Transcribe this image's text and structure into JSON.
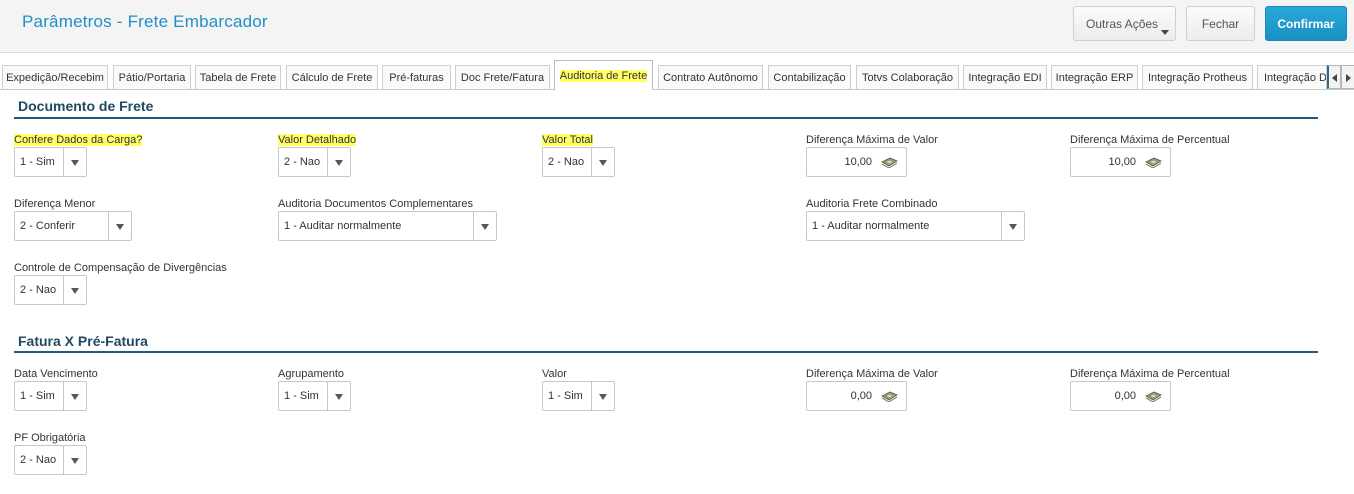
{
  "header": {
    "title": "Parâmetros - Frete Embarcador",
    "buttons": {
      "outras": "Outras Ações",
      "fechar": "Fechar",
      "confirmar": "Confirmar"
    }
  },
  "tabs": [
    "Expedição/Recebim",
    "Pátio/Portaria",
    "Tabela de Frete",
    "Cálculo de Frete",
    "Pré-faturas",
    "Doc Frete/Fatura",
    "Auditoria de Frete",
    "Contrato Autônomo",
    "Contabilização",
    "Totvs Colaboração",
    "Integração EDI",
    "Integração ERP",
    "Integração Protheus",
    "Integração D"
  ],
  "sections": {
    "doc": {
      "title": "Documento de Frete",
      "confere": {
        "label": "Confere Dados da Carga?",
        "value": "1 - Sim"
      },
      "valor_detalhado": {
        "label": "Valor Detalhado",
        "value": "2 - Nao"
      },
      "valor_total": {
        "label": "Valor Total",
        "value": "2 - Nao"
      },
      "dif_valor": {
        "label": "Diferença Máxima de Valor",
        "value": "10,00"
      },
      "dif_percentual": {
        "label": "Diferença Máxima de Percentual",
        "value": "10,00"
      },
      "dif_menor": {
        "label": "Diferença Menor",
        "value": "2 - Conferir"
      },
      "aud_complementares": {
        "label": "Auditoria Documentos Complementares",
        "value": "1 - Auditar normalmente"
      },
      "aud_combinado": {
        "label": "Auditoria Frete Combinado",
        "value": "1 - Auditar normalmente"
      },
      "controle_compensacao": {
        "label": "Controle de Compensação de Divergências",
        "value": "2 - Nao"
      }
    },
    "fatura": {
      "title": "Fatura X Pré-Fatura",
      "data_vencimento": {
        "label": "Data Vencimento",
        "value": "1 - Sim"
      },
      "agrupamento": {
        "label": "Agrupamento",
        "value": "1 - Sim"
      },
      "valor": {
        "label": "Valor",
        "value": "1 - Sim"
      },
      "dif_valor": {
        "label": "Diferença Máxima de Valor",
        "value": "0,00"
      },
      "dif_percentual": {
        "label": "Diferença Máxima de Percentual",
        "value": "0,00"
      },
      "pf_obrigatoria": {
        "label": "PF Obrigatória",
        "value": "2 - Nao"
      }
    }
  },
  "colors": {
    "accent": "#1e90c8",
    "section": "#235a78",
    "highlight": "#ffff66"
  },
  "icons": {
    "money": "money-icon",
    "dropdown": "chevron-down-icon"
  }
}
